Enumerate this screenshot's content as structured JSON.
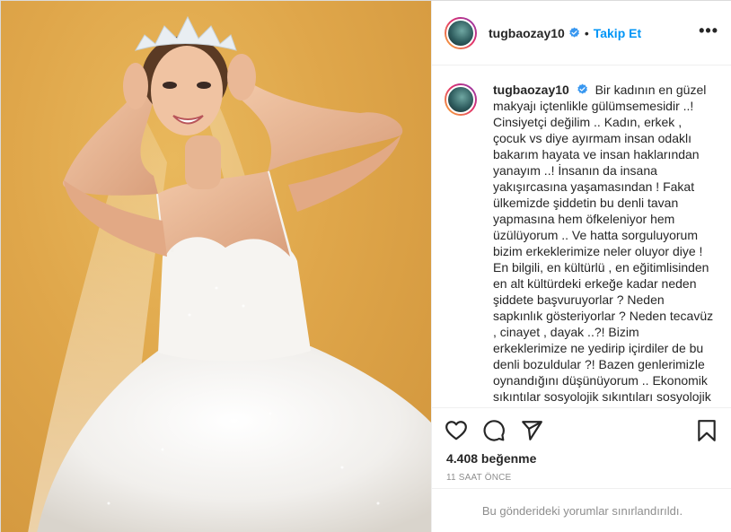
{
  "post": {
    "username": "tugbaozay10",
    "verified": true,
    "separator": "•",
    "follow_label": "Takip Et",
    "more_label": "•••",
    "caption_user": "tugbaozay10",
    "caption_text": "Bir kadının en güzel makyajı içtenlikle gülümsemesidir ..! Cinsiyetçi değilim .. Kadın, erkek , çocuk vs diye ayırmam insan odaklı bakarım hayata ve insan haklarından yanayım ..! İnsanın da insana yakışırcasına yaşamasından ! Fakat ülkemizde şiddetin bu denli tavan yapmasına hem öfkeleniyor hem üzülüyorum .. Ve hatta sorguluyorum bizim erkeklerimize neler oluyor diye ! En bilgili, en kültürlü , en eğitimlisinden en alt kültürdeki erkeğe kadar neden şiddete başvuruyorlar ? Neden sapkınlık gösteriyorlar ? Neden tecavüz , cinayet , dayak ..?! Bizim erkeklerimize ne yedirip içirdiler de bu denli bozuldular ?! Bazen genlerimizle oynandığını düşünüyorum .. Ekonomik sıkıntılar sosyolojik sıkıntıları sosyolojik",
    "likes": "4.408 beğenme",
    "time": "11 SAAT ÖNCE",
    "comments_restricted": "Bu gönderideki yorumlar sınırlandırıldı."
  },
  "icons": {
    "verified": "verified-badge-icon",
    "like": "heart-icon",
    "comment": "comment-bubble-icon",
    "share": "paper-plane-icon",
    "save": "bookmark-icon"
  },
  "colors": {
    "accent": "#0095f6",
    "text": "#262626",
    "muted": "#8e8e8e",
    "border": "#efefef",
    "photo_background": "#dfa64a"
  }
}
